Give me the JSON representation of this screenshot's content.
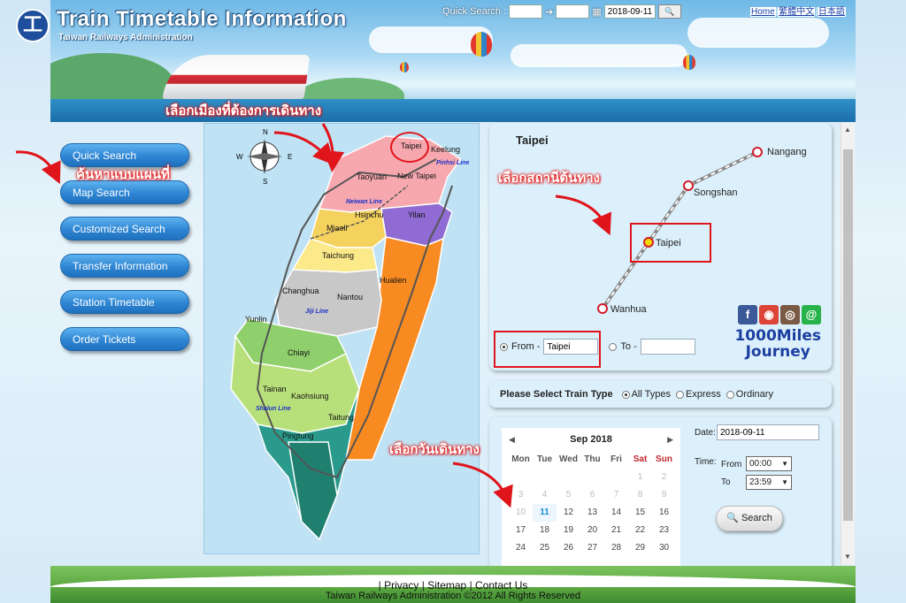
{
  "header": {
    "logo_glyph": "工",
    "title": "Train Timetable Information",
    "subtitle": "Taiwan Railways Administration"
  },
  "quick_search": {
    "label": "Quick Search :",
    "arrow": "➔",
    "date": "2018-09-11",
    "go_icon": "search-icon"
  },
  "top_links": [
    "Home",
    "繁體中文",
    "日本語"
  ],
  "nav": [
    "Quick Search",
    "Map Search",
    "Customized Search",
    "Transfer Information",
    "Station Timetable",
    "Order Tickets"
  ],
  "map": {
    "compass": [
      "N",
      "E",
      "S",
      "W"
    ],
    "regions": [
      "Taipei",
      "Keelung",
      "Taoyuan",
      "New Taipei",
      "Hsinchu",
      "Yilan",
      "Miaoli",
      "Taichung",
      "Hualien",
      "Changhua",
      "Nantou",
      "Yunlin",
      "Chiayi",
      "Tainan",
      "Kaohsiung",
      "Taitung",
      "Pingtung"
    ],
    "lines": [
      "Pinhsi Line",
      "Neiwan Line",
      "Jiji Line",
      "Shalun Line"
    ],
    "colors": {
      "north": "#f6a0a8",
      "west": "#fbe98a",
      "yilan": "#8f6bd3",
      "east": "#f88a22",
      "central": "#b8b8b8",
      "south": "#2a9a8c",
      "green": "#8fcf6c"
    }
  },
  "station": {
    "region_title": "Taipei",
    "stations": [
      "Nangang",
      "Songshan",
      "Taipei",
      "Wanhua"
    ],
    "from_label": "From -",
    "from_value": "Taipei",
    "to_label": "To -",
    "to_value": "",
    "brand_line1": "1000Miles",
    "brand_line2": "Journey"
  },
  "train_type": {
    "title": "Please Select Train Type",
    "options": [
      "All Types",
      "Express",
      "Ordinary"
    ],
    "selected": "All Types"
  },
  "calendar": {
    "title": "Sep  2018",
    "weekdays": [
      "Mon",
      "Tue",
      "Wed",
      "Thu",
      "Fri",
      "Sat",
      "Sun"
    ],
    "days": [
      [
        "",
        "",
        "",
        "",
        "",
        "1",
        "2"
      ],
      [
        "3",
        "4",
        "5",
        "6",
        "7",
        "8",
        "9"
      ],
      [
        "10",
        "11",
        "12",
        "13",
        "14",
        "15",
        "16"
      ],
      [
        "17",
        "18",
        "19",
        "20",
        "21",
        "22",
        "23"
      ],
      [
        "24",
        "25",
        "26",
        "27",
        "28",
        "29",
        "30"
      ]
    ],
    "today": "11"
  },
  "date_form": {
    "date_label": "Date:",
    "date_value": "2018-09-11",
    "time_label": "Time:",
    "from_label": "From",
    "from_value": "00:00",
    "to_label": "To",
    "to_value": "23:59",
    "search_label": "Search"
  },
  "footer": {
    "links": [
      "Privacy",
      "Sitemap",
      "Contact Us"
    ],
    "copyright": "Taiwan Railways Administration ©2012 All Rights Reserved"
  },
  "annotations": {
    "select_city": "เลือกเมืองที่ต้องการเดินทาง",
    "map_search": "ค้นหาแบบแผนที่",
    "select_origin": "เลือกสถานีต้นทาง",
    "select_date": "เลือกวันเดินทาง"
  }
}
